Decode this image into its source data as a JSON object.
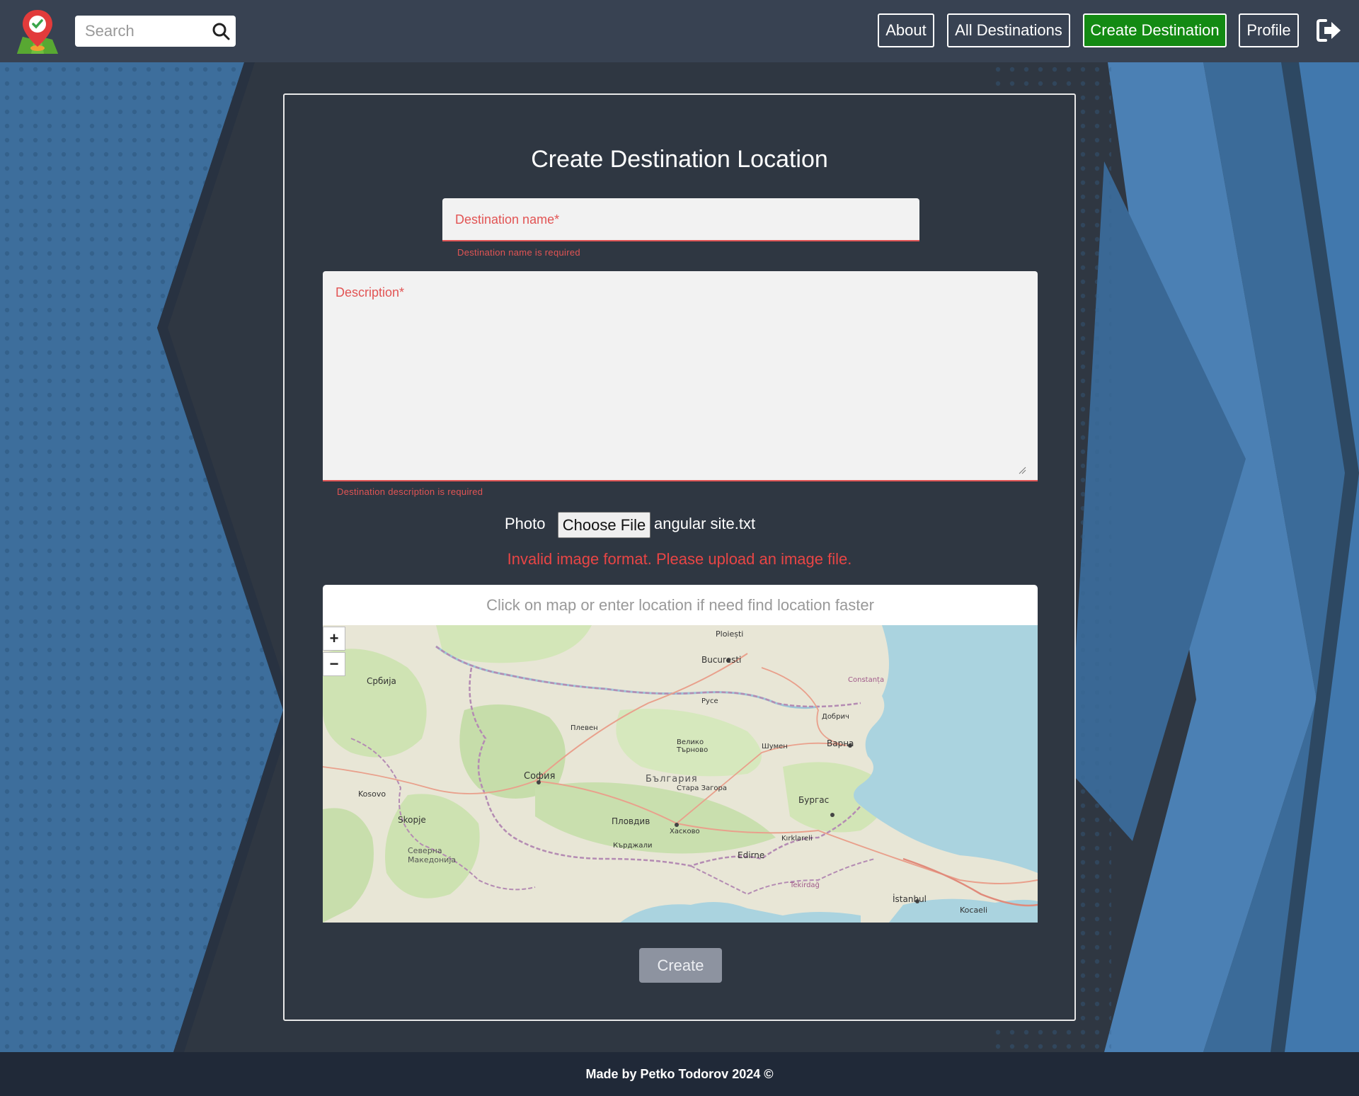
{
  "header": {
    "search_placeholder": "Search",
    "nav": {
      "about": "About",
      "all_destinations": "All Destinations",
      "create_destination": "Create Destination",
      "profile": "Profile"
    }
  },
  "form": {
    "title": "Create Destination Location",
    "name_label": "Destination name*",
    "name_error": "Destination name is required",
    "description_label": "Description*",
    "description_error": "Destination description is required",
    "photo_label": "Photo",
    "choose_file_label": "Choose File",
    "file_name": "angular site.txt",
    "image_error": "Invalid image format. Please upload an image file.",
    "location_placeholder": "Click on map or enter location if need find location faster",
    "map": {
      "zoom_in": "+",
      "zoom_out": "−",
      "labels": [
        "Bucuresti",
        "Ploiești",
        "Constanța",
        "Варна",
        "Бургас",
        "София",
        "България",
        "Пловдив",
        "Стара Загора",
        "Edirne",
        "İstanbul",
        "Kocaeli",
        "Skopje",
        "Србија",
        "Kosovo",
        "Северна Македонија",
        "Плевен",
        "Велико Търново",
        "Шумен",
        "Добрич",
        "Русе",
        "Хасково",
        "Кърджали",
        "Tekirdağ",
        "Kırklareli"
      ]
    },
    "submit_label": "Create"
  },
  "footer": {
    "text": "Made by Petko Todorov 2024 ©"
  },
  "colors": {
    "header_bg": "#384252",
    "card_bg": "#2f3742",
    "accent_green": "#138a13",
    "error_red": "#e25454",
    "footer_bg": "#202938",
    "background_blue": "#3d6e9c"
  }
}
